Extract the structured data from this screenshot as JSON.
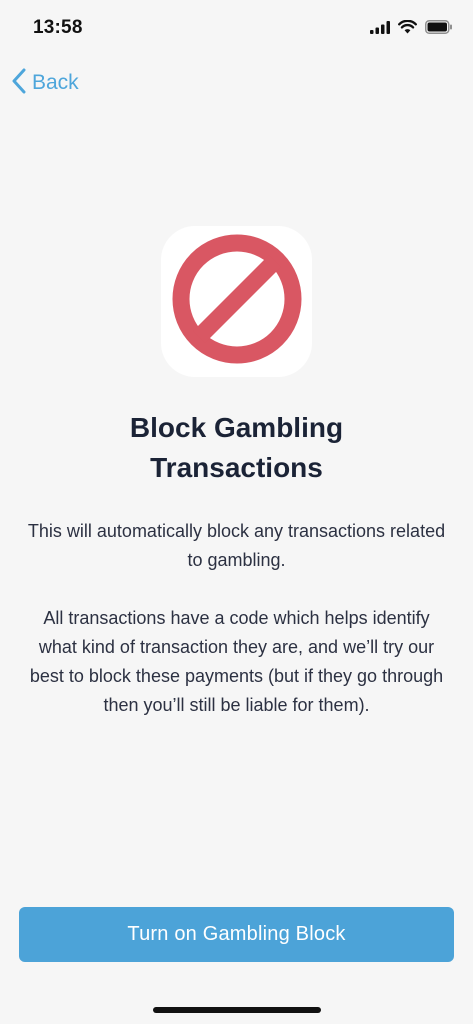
{
  "status_bar": {
    "time": "13:58"
  },
  "nav": {
    "back_label": "Back"
  },
  "icon": {
    "name": "prohibited-icon",
    "color": "#d95763"
  },
  "content": {
    "title": "Block Gambling\nTransactions",
    "paragraph1": "This will automatically block any transactions related to gambling.",
    "paragraph2": "All transactions have a code which helps identify what kind of transaction they are, and we’ll try our best to block these payments (but if they go through then you’ll still be liable for them)."
  },
  "actions": {
    "primary_label": "Turn on Gambling Block"
  },
  "colors": {
    "accent": "#4ca3d8",
    "link": "#4ea6db",
    "background": "#f6f6f6"
  }
}
